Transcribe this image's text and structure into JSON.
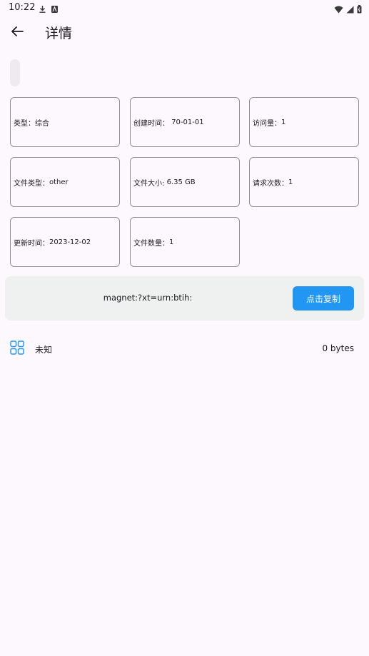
{
  "status": {
    "time": "10:22"
  },
  "header": {
    "title": "详情"
  },
  "cards": [
    {
      "label": "类型：",
      "value": "综合"
    },
    {
      "label": "创建时间： ",
      "value": "70-01-01"
    },
    {
      "label": "访问量：",
      "value": "1"
    },
    {
      "label": "文件类型：",
      "value": "other"
    },
    {
      "label": "文件大小: ",
      "value": "6.35 GB"
    },
    {
      "label": "请求次数：",
      "value": "1"
    },
    {
      "label": "更新时间：",
      "value": "2023-12-02"
    },
    {
      "label": "文件数量：",
      "value": "1"
    }
  ],
  "magnet": {
    "text": "magnet:?xt=urn:btih:",
    "copy_label": "点击复制"
  },
  "files": [
    {
      "name": "未知",
      "size": "0 bytes"
    }
  ],
  "colors": {
    "accent": "#2196f3",
    "background": "#fdf8fd",
    "magnet_bg": "#eff0f0"
  },
  "icons": {
    "back": "arrow-left-icon",
    "file": "grid-icon"
  }
}
